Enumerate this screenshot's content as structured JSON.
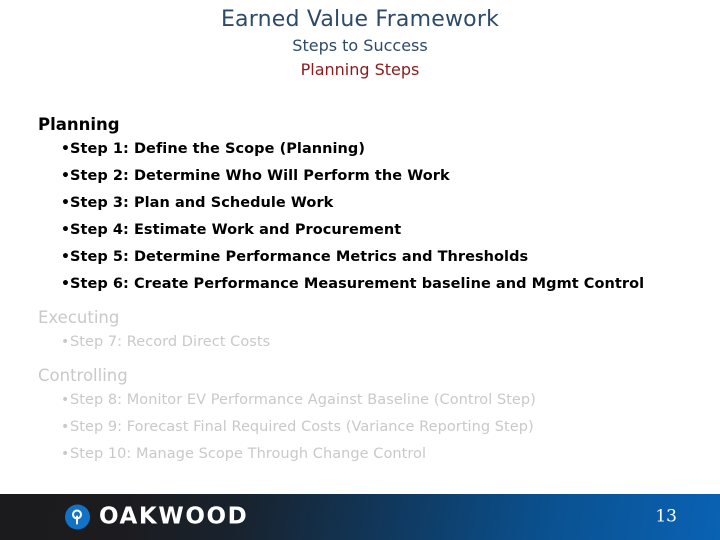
{
  "slide": {
    "title": "Earned Value Framework",
    "subtitle": "Steps to Success",
    "section_label": "Planning Steps",
    "title_color": "#2d4a6b",
    "section_label_color": "#8b1a1a"
  },
  "groups": [
    {
      "heading": "Planning",
      "state": "active",
      "bullet_char": "•",
      "items": [
        {
          "text": "Step 1: Define the Scope (Planning)"
        },
        {
          "text": "Step 2: Determine Who Will Perform the Work"
        },
        {
          "text": "Step 3: Plan and Schedule Work"
        },
        {
          "text": "Step 4: Estimate Work and Procurement"
        },
        {
          "text": "Step 5: Determine Performance Metrics and Thresholds"
        },
        {
          "text": "Step 6: Create Performance Measurement baseline and Mgmt Control"
        }
      ]
    },
    {
      "heading": "Executing",
      "state": "dimmed",
      "bullet_char": "•",
      "items": [
        {
          "text": "Step 7: Record Direct Costs"
        }
      ]
    },
    {
      "heading": "Controlling",
      "state": "dimmed",
      "bullet_char": "•",
      "items": [
        {
          "text": "Step 8: Monitor EV Performance Against Baseline (Control Step)"
        },
        {
          "text": "Step 9: Forecast Final Required Costs (Variance Reporting Step)"
        },
        {
          "text": "Step 10: Manage Scope Through Change Control"
        }
      ]
    }
  ],
  "footer": {
    "brand_name": "OAKWOOD",
    "brand_mark_icon": "oakwood-logo-icon",
    "brand_mark_color": "#1273c4",
    "page_number": "13",
    "gradient_start": "#1b1b1d",
    "gradient_end": "#0a62b4"
  }
}
